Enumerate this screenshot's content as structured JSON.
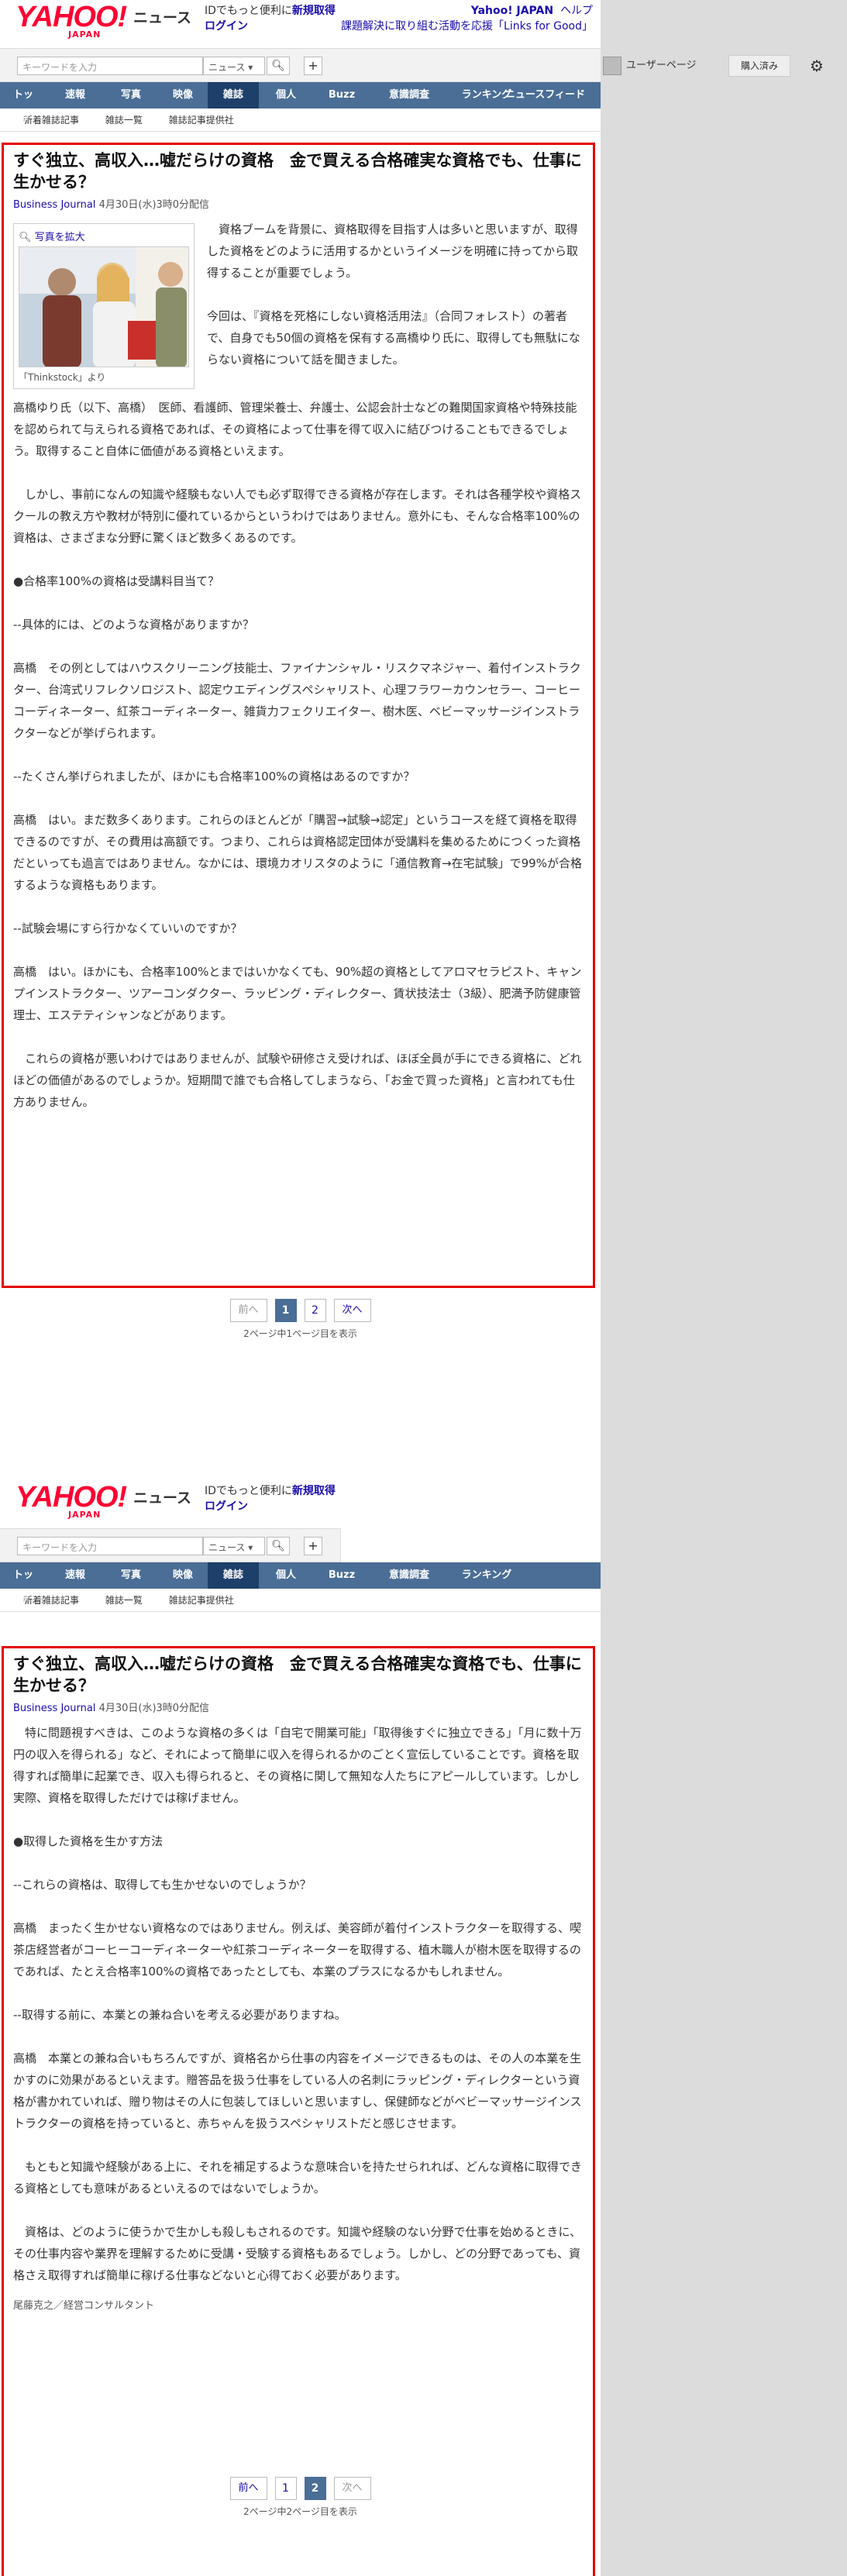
{
  "brand": {
    "logo": "YAHOO!",
    "logo_sub": "JAPAN",
    "service": "ニュース"
  },
  "header": {
    "id_promo": "IDでもっと便利に",
    "signup": "新規取得",
    "login": "ログイン",
    "yahoo_japan": "Yahoo! JAPAN",
    "help": "ヘルプ",
    "campaign": "課題解決に取り組む活動を応援「Links for Good」"
  },
  "search": {
    "placeholder": "キーワードを入力",
    "select": "ニュース ▾",
    "icon": "search-icon",
    "plus": "+"
  },
  "user": {
    "page": "ユーザーページ",
    "purchased": "購入済み",
    "icon": "gear-icon"
  },
  "nav": {
    "tabs": [
      "トップ",
      "速報",
      "写真",
      "映像",
      "雑誌",
      "個人",
      "Buzz",
      "意識調査",
      "ランキング"
    ],
    "active": "雑誌",
    "feed": "ニュースフィード"
  },
  "subnav": [
    "新着雑誌記事",
    "雑誌一覧",
    "雑誌記事提供社"
  ],
  "article": {
    "title": "すぐ独立、高収入…嘘だらけの資格　金で買える合格確実な資格でも、仕事に生かせる？",
    "source": "Business Journal",
    "date": "4月30日(水)3時0分配信",
    "enlarge": "写真を拡大",
    "caption": "「Thinkstock」より"
  },
  "page1": {
    "lead": "資格ブームを背景に、資格取得を目指す人は多いと思いますが、取得した資格をどのように活用するかというイメージを明確に持ってから取得することが重要でしょう。",
    "intro": "今回は、『資格を死格にしない資格活用法』（合同フォレスト）の著者で、自身でも50個の資格を保有する高橋ゆり氏に、取得しても無駄にならない資格について話を聞きました。",
    "paras": [
      "高橋ゆり氏（以下、高橋）　医師、看護師、管理栄養士、弁護士、公認会計士などの難関国家資格や特殊技能を認められて与えられる資格であれば、その資格によって仕事を得て収入に結びつけることもできるでしょう。取得すること自体に価値がある資格といえます。",
      "　しかし、事前になんの知識や経験もない人でも必ず取得できる資格が存在します。それは各種学校や資格スクールの教え方や教材が特別に優れているからというわけではありません。意外にも、そんな合格率100%の資格は、さまざまな分野に驚くほど数多くあるのです。",
      "●合格率100%の資格は受講料目当て？",
      "--具体的には、どのような資格がありますか？",
      "高橋　その例としてはハウスクリーニング技能士、ファイナンシャル・リスクマネジャー、着付インストラクター、台湾式リフレクソロジスト、認定ウエディングスペシャリスト、心理フラワーカウンセラー、コーヒーコーディネーター、紅茶コーディネーター、雑貨力フェクリエイター、樹木医、ベビーマッサージインストラクターなどが挙げられます。",
      "--たくさん挙げられましたが、ほかにも合格率100%の資格はあるのですか？",
      "高橋　はい。まだ数多くあります。これらのほとんどが「購習→試験→認定」というコースを経て資格を取得できるのですが、その費用は高額です。つまり、これらは資格認定団体が受講料を集めるためにつくった資格だといっても過言ではありません。なかには、環境カオリスタのように「通信教育→在宅試験」で99%が合格するような資格もあります。",
      "--試験会場にすら行かなくていいのですか？",
      "高橋　はい。ほかにも、合格率100%とまではいかなくても、90%超の資格としてアロマセラピスト、キャンプインストラクター、ツアーコンダクター、ラッピング・ディレクター、賃状技法士（3級）、肥満予防健康管理士、エステティシャンなどがあります。",
      "　これらの資格が悪いわけではありませんが、試験や研修さえ受ければ、ほぼ全員が手にできる資格に、どれほどの価値があるのでしょうか。短期間で誰でも合格してしまうなら、「お金で買った資格」と言われても仕方ありません。"
    ]
  },
  "page2": {
    "paras": [
      "　特に問題視すべきは、このような資格の多くは「自宅で開業可能」「取得後すぐに独立できる」「月に数十万円の収入を得られる」など、それによって簡単に収入を得られるかのごとく宣伝していることです。資格を取得すれば簡単に起業でき、収入も得られると、その資格に関して無知な人たちにアピールしています。しかし実際、資格を取得しただけでは稼げません。",
      "●取得した資格を生かす方法",
      "--これらの資格は、取得しても生かせないのでしょうか？",
      "高橋　まったく生かせない資格なのではありません。例えば、美容師が着付インストラクターを取得する、喫茶店経営者がコーヒーコーディネーターや紅茶コーディネーターを取得する、植木職人が樹木医を取得するのであれば、たとえ合格率100%の資格であったとしても、本業のプラスになるかもしれません。",
      "--取得する前に、本業との兼ね合いを考える必要がありますね。",
      "高橋　本業との兼ね合いもちろんですが、資格名から仕事の内容をイメージできるものは、その人の本業を生かすのに効果があるといえます。贈答品を扱う仕事をしている人の名刺にラッピング・ディレクターという資格が書かれていれば、贈り物はその人に包装してほしいと思いますし、保健師などがベビーマッサージインストラクターの資格を持っていると、赤ちゃんを扱うスペシャリストだと感じさせます。",
      "　もともと知識や経験がある上に、それを補足するような意味合いを持たせられれば、どんな資格に取得できる資格としても意味があるといえるのではないでしょうか。",
      "　資格は、どのように使うかで生かしも殺しもされるのです。知識や経験のない分野で仕事を始めるときに、その仕事内容や業界を理解するために受講・受験する資格もあるでしょう。しかし、どの分野であっても、資格さえ取得すれば簡単に稼げる仕事などないと心得ておく必要があります。"
    ],
    "byline": "尾藤克之／経営コンサルタント"
  },
  "pager1": {
    "prev": "前へ",
    "pages": [
      "1",
      "2"
    ],
    "current": "1",
    "next": "次へ",
    "status": "2ページ中1ページ目を表示"
  },
  "pager2": {
    "prev": "前へ",
    "pages": [
      "1",
      "2"
    ],
    "current": "2",
    "next": "次へ",
    "status": "2ページ中2ページ目を表示"
  },
  "colors": {
    "accent": "#e50000",
    "nav": "#4a6e96",
    "nav_active": "#1d3f6a",
    "link": "#1a0dab",
    "brand": "#ff0033"
  }
}
